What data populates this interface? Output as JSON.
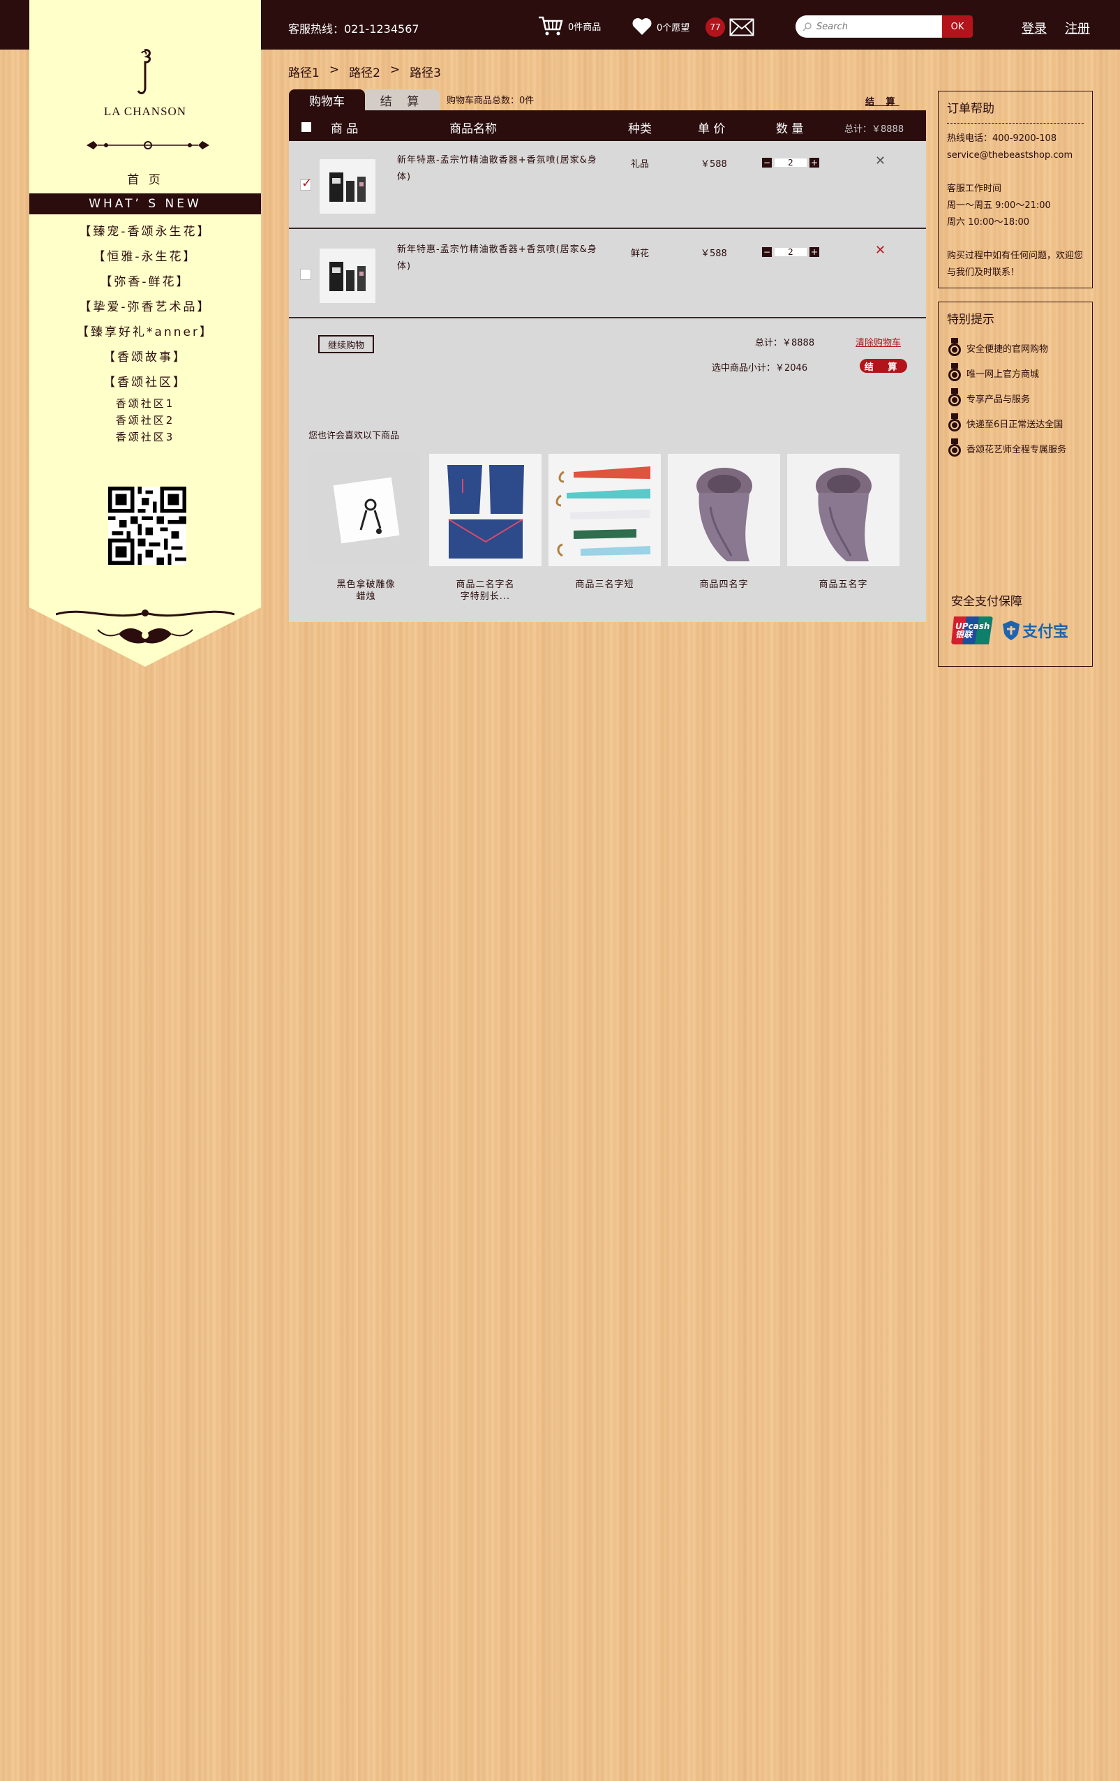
{
  "header": {
    "hotline": "客服热线：021-1234567",
    "cart_label": "0件商品",
    "wish_label": "0个愿望",
    "msg_count": "77",
    "search_placeholder": "Search",
    "search_button": "OK",
    "login": "登录",
    "register": "注册"
  },
  "sidebar": {
    "logo_text": "LA CHANSON",
    "home": "首 页",
    "whats_new": "WHAT’ S NEW",
    "items": [
      "【臻宠-香颂永生花】",
      "【恒雅-永生花】",
      "【弥香-鲜花】",
      "【挚爱-弥香艺术品】",
      "【臻享好礼*anner】",
      "【香颂故事】",
      "【香颂社区】"
    ],
    "sub_items": [
      "香颂社区1",
      "香颂社区2",
      "香颂社区3"
    ]
  },
  "breadcrumb": [
    "路径1",
    ">",
    "路径2",
    ">",
    "路径3"
  ],
  "cart": {
    "tab_cart": "购物车",
    "tab_checkout": "结 算",
    "count_label": "购物车商品总数：0件",
    "checkout_link": "结 算",
    "headers": {
      "product": "商 品",
      "name": "商品名称",
      "type": "种类",
      "price": "单 价",
      "qty": "数 量",
      "total": "总计：￥8888"
    },
    "rows": [
      {
        "name": "新年特惠-孟宗竹精油散香器+香氛喷(居家&身体)",
        "type": "礼品",
        "price": "￥588",
        "qty": "2",
        "checked": true
      },
      {
        "name": "新年特惠-孟宗竹精油散香器+香氛喷(居家&身体)",
        "type": "鲜花",
        "price": "￥588",
        "qty": "2",
        "checked": false
      }
    ],
    "continue": "继续购物",
    "total": "总计：￥8888",
    "clear": "清除购物车",
    "subtotal": "选中商品小计：￥2046",
    "checkout_button": "结 算",
    "rec_title": "您也许会喜欢以下商品",
    "recommended": [
      {
        "name": "黑色拿破雕像\n蜡烛"
      },
      {
        "name": "商品二名字名\n字特别长..."
      },
      {
        "name": "商品三名字短"
      },
      {
        "name": "商品四名字"
      },
      {
        "name": "商品五名字"
      }
    ]
  },
  "help": {
    "title": "订单帮助",
    "phone": "热线电话：400-9200-108",
    "email": "service@thebeastshop.com",
    "hours_title": "客服工作时间",
    "hours_weekday": "周一～周五 9:00～21:00",
    "hours_sat": "周六 10:00～18:00",
    "note": "购买过程中如有任何问题，欢迎您与我们及时联系！"
  },
  "tips": {
    "title": "特别提示",
    "items": [
      "安全便捷的官网购物",
      "唯一网上官方商城",
      "专享产品与服务",
      "快递至6日正常送达全国",
      "香颂花艺师全程专属服务"
    ],
    "pay_title": "安全支付保障",
    "unionpay": "UPcash\n银联",
    "alipay": "支付宝"
  },
  "colors": {
    "brand_dark": "#2b0d0e",
    "accent_red": "#b3141b",
    "sidebar_bg": "#ffffc9",
    "panel_bg": "#d9d9d9"
  }
}
